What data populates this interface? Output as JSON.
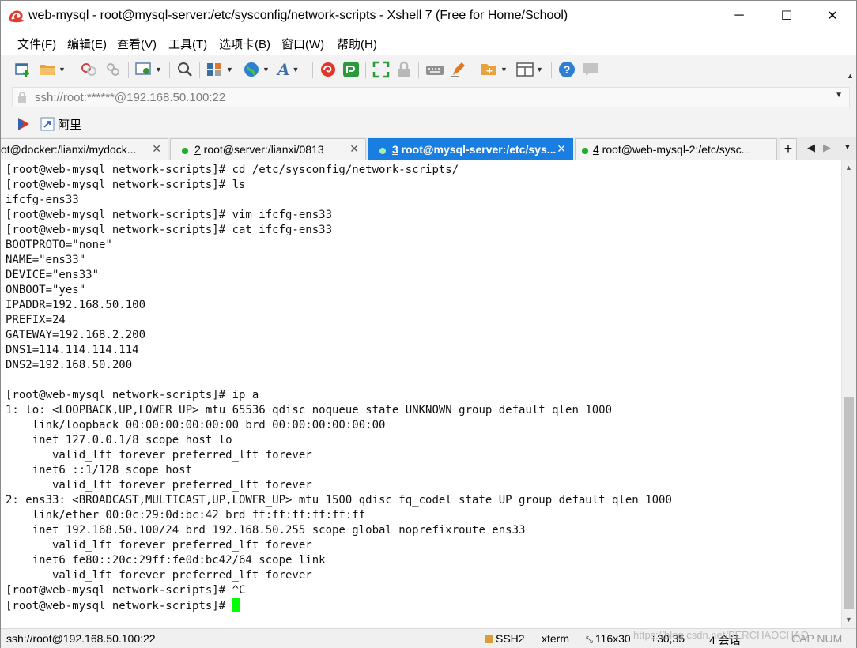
{
  "window": {
    "title": "web-mysql - root@mysql-server:/etc/sysconfig/network-scripts - Xshell 7 (Free for Home/School)",
    "minimize": "─",
    "maximize": "☐",
    "close": "✕"
  },
  "menu": [
    "文件(F)",
    "编辑(E)",
    "查看(V)",
    "工具(T)",
    "选项卡(B)",
    "窗口(W)",
    "帮助(H)"
  ],
  "address": {
    "value": "ssh://root:******@192.168.50.100:22"
  },
  "quickbar": {
    "link_label": "阿里"
  },
  "tabs": [
    {
      "label": "ot@docker:/lianxi/mydock...",
      "num": "",
      "active": false
    },
    {
      "num": "2",
      "label": " root@server:/lianxi/0813",
      "active": false
    },
    {
      "num": "3",
      "label": " root@mysql-server:/etc/sys...",
      "active": true
    },
    {
      "num": "4",
      "label": " root@web-mysql-2:/etc/sysc...",
      "active": false
    }
  ],
  "tab_add": "+",
  "terminal": {
    "lines": [
      "[root@web-mysql network-scripts]# cd /etc/sysconfig/network-scripts/",
      "[root@web-mysql network-scripts]# ls",
      "ifcfg-ens33",
      "[root@web-mysql network-scripts]# vim ifcfg-ens33",
      "[root@web-mysql network-scripts]# cat ifcfg-ens33",
      "BOOTPROTO=\"none\"",
      "NAME=\"ens33\"",
      "DEVICE=\"ens33\"",
      "ONBOOT=\"yes\"",
      "IPADDR=192.168.50.100",
      "PREFIX=24",
      "GATEWAY=192.168.2.200",
      "DNS1=114.114.114.114",
      "DNS2=192.168.50.200",
      "",
      "[root@web-mysql network-scripts]# ip a",
      "1: lo: <LOOPBACK,UP,LOWER_UP> mtu 65536 qdisc noqueue state UNKNOWN group default qlen 1000",
      "    link/loopback 00:00:00:00:00:00 brd 00:00:00:00:00:00",
      "    inet 127.0.0.1/8 scope host lo",
      "       valid_lft forever preferred_lft forever",
      "    inet6 ::1/128 scope host",
      "       valid_lft forever preferred_lft forever",
      "2: ens33: <BROADCAST,MULTICAST,UP,LOWER_UP> mtu 1500 qdisc fq_codel state UP group default qlen 1000",
      "    link/ether 00:0c:29:0d:bc:42 brd ff:ff:ff:ff:ff:ff",
      "    inet 192.168.50.100/24 brd 192.168.50.255 scope global noprefixroute ens33",
      "       valid_lft forever preferred_lft forever",
      "    inet6 fe80::20c:29ff:fe0d:bc42/64 scope link",
      "       valid_lft forever preferred_lft forever",
      "[root@web-mysql network-scripts]# ^C"
    ],
    "prompt": "[root@web-mysql network-scripts]# ",
    "cursor_color": "#00ff00"
  },
  "status": {
    "connection": "ssh://root@192.168.50.100:22",
    "protocol": "SSH2",
    "term_type": "xterm",
    "size": "116x30",
    "position": "30,35",
    "sessions": "4 会话",
    "caps": "CAP NUM"
  },
  "watermark": "https://blog.csdn.net/PERCHAOCHAO",
  "colors": {
    "accent": "#1a7ee0",
    "tab_dot": "#1cad2b",
    "cursor": "#00ff00"
  }
}
